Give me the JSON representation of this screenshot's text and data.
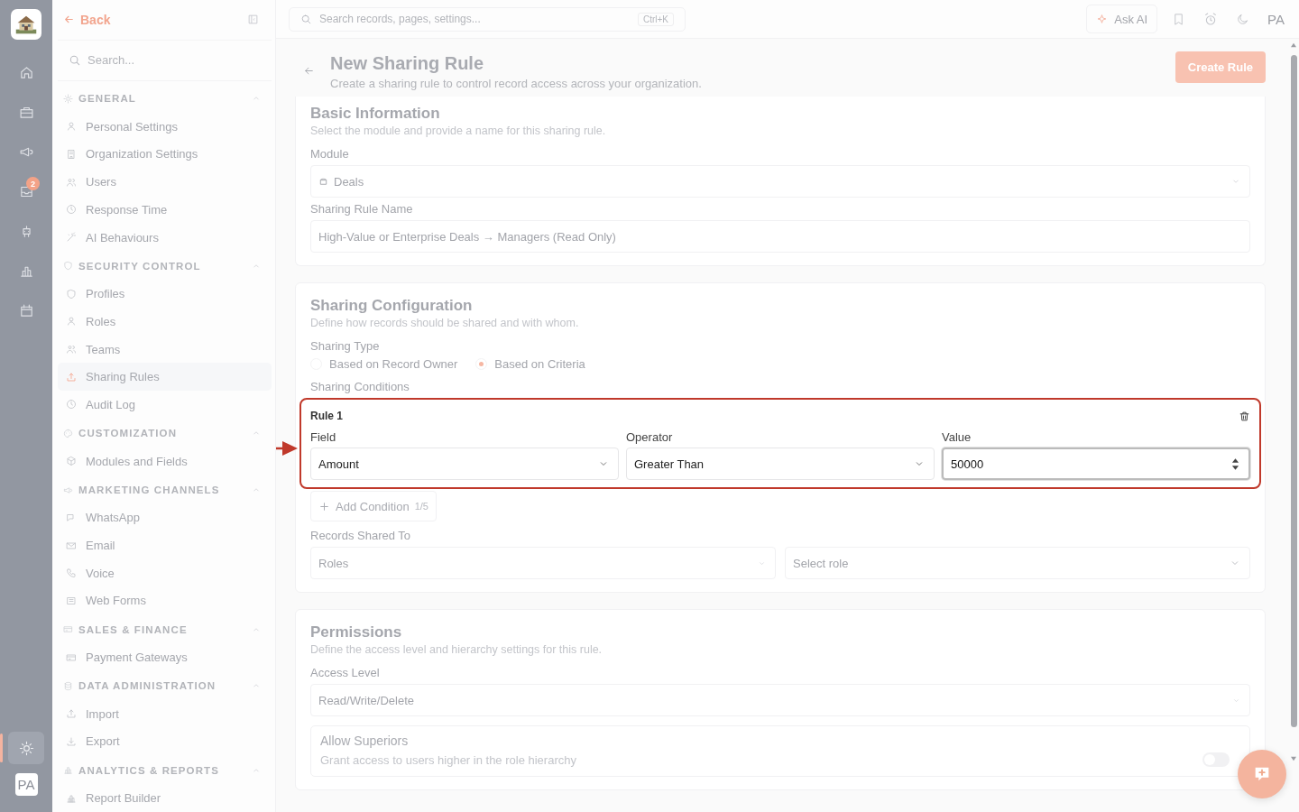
{
  "rail": {
    "items": [
      {
        "selected": false
      },
      {
        "selected": false
      },
      {
        "selected": false
      },
      {
        "selected": false,
        "badge": "2"
      },
      {
        "selected": false
      },
      {
        "selected": false
      },
      {
        "selected": false
      }
    ],
    "settings": {
      "selected": true
    },
    "avatar": "PA"
  },
  "sidebar": {
    "back": "Back",
    "search_placeholder": "Search...",
    "groups": [
      {
        "title": "GENERAL",
        "expanded": true,
        "items": [
          {
            "label": "Personal Settings",
            "selected": false
          },
          {
            "label": "Organization Settings",
            "selected": false
          },
          {
            "label": "Users",
            "selected": false
          },
          {
            "label": "Response Time",
            "selected": false
          },
          {
            "label": "AI Behaviours",
            "selected": false
          }
        ]
      },
      {
        "title": "SECURITY CONTROL",
        "expanded": true,
        "items": [
          {
            "label": "Profiles",
            "selected": false
          },
          {
            "label": "Roles",
            "selected": false
          },
          {
            "label": "Teams",
            "selected": false
          },
          {
            "label": "Sharing Rules",
            "selected": true
          },
          {
            "label": "Audit Log",
            "selected": false
          }
        ]
      },
      {
        "title": "CUSTOMIZATION",
        "expanded": true,
        "items": [
          {
            "label": "Modules and Fields",
            "selected": false
          }
        ]
      },
      {
        "title": "MARKETING CHANNELS",
        "expanded": true,
        "items": [
          {
            "label": "WhatsApp",
            "selected": false
          },
          {
            "label": "Email",
            "selected": false
          },
          {
            "label": "Voice",
            "selected": false
          },
          {
            "label": "Web Forms",
            "selected": false
          }
        ]
      },
      {
        "title": "SALES & FINANCE",
        "expanded": true,
        "items": [
          {
            "label": "Payment Gateways",
            "selected": false
          }
        ]
      },
      {
        "title": "DATA ADMINISTRATION",
        "expanded": true,
        "items": [
          {
            "label": "Import",
            "selected": false
          },
          {
            "label": "Export",
            "selected": false
          }
        ]
      },
      {
        "title": "ANALYTICS & REPORTS",
        "expanded": true,
        "items": [
          {
            "label": "Report Builder",
            "selected": false
          }
        ]
      }
    ]
  },
  "topbar": {
    "search_placeholder": "Search records, pages, settings...",
    "shortcut": "Ctrl+K",
    "ask_ai": "Ask AI",
    "avatar": "PA"
  },
  "header": {
    "title": "New Sharing Rule",
    "subtitle": "Create a sharing rule to control record access across your organization.",
    "create_button": "Create Rule"
  },
  "basic": {
    "title": "Basic Information",
    "subtitle": "Select the module and provide a name for this sharing rule.",
    "module_label": "Module",
    "module_value": "Deals",
    "name_label": "Sharing Rule Name",
    "name_value": "High-Value or Enterprise Deals → Managers (Read Only)"
  },
  "config": {
    "title": "Sharing Configuration",
    "subtitle": "Define how records should be shared and with whom.",
    "sharing_type_label": "Sharing Type",
    "sharing_types": [
      {
        "label": "Based on Record Owner",
        "selected": false
      },
      {
        "label": "Based on Criteria",
        "selected": true
      }
    ],
    "conditions_label": "Sharing Conditions",
    "rules": [
      {
        "title": "Rule 1",
        "highlighted": true,
        "fields": [
          {
            "label": "Field",
            "value": "Amount",
            "kind": "select"
          },
          {
            "label": "Operator",
            "value": "Greater Than",
            "kind": "select"
          },
          {
            "label": "Value",
            "value": "50000",
            "kind": "number"
          }
        ]
      }
    ],
    "add_condition": {
      "label": "Add Condition",
      "count": "1/5"
    },
    "shared_to_label": "Records Shared To",
    "shared_to_value": "Roles",
    "role_placeholder": "Select role"
  },
  "permissions": {
    "title": "Permissions",
    "subtitle": "Define the access level and hierarchy settings for this rule.",
    "access_label": "Access Level",
    "access_value": "Read/Write/Delete",
    "allow_superiors": {
      "title": "Allow Superiors",
      "description": "Grant access to users higher in the role hierarchy",
      "on": false
    }
  }
}
